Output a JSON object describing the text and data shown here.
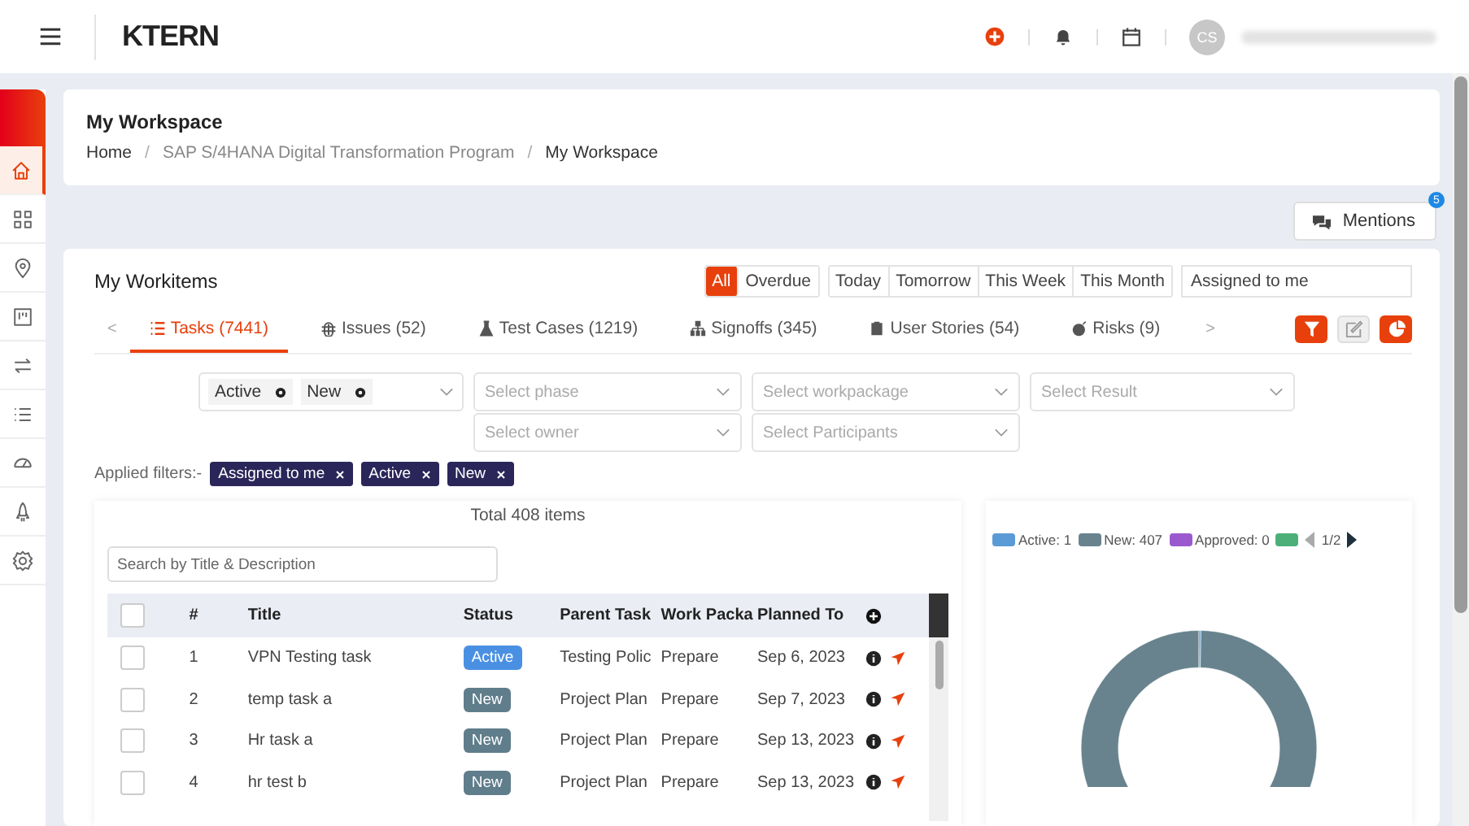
{
  "header": {
    "logo": "KTERN",
    "avatar": "CS"
  },
  "sidebar": {
    "items": [
      {
        "kind": "home",
        "selected": true
      },
      {
        "kind": "grid",
        "selected": false
      },
      {
        "kind": "pin",
        "selected": false
      },
      {
        "kind": "board",
        "selected": false
      },
      {
        "kind": "swap",
        "selected": false
      },
      {
        "kind": "list",
        "selected": false
      },
      {
        "kind": "gauge",
        "selected": false
      },
      {
        "kind": "rocket",
        "selected": false
      },
      {
        "kind": "gear",
        "selected": false
      }
    ]
  },
  "page": {
    "title": "My Workspace",
    "breadcrumb": [
      {
        "label": "Home"
      },
      {
        "label": "SAP S/4HANA Digital Transformation Program"
      },
      {
        "label": "My Workspace"
      }
    ],
    "separator": "/"
  },
  "mentions": {
    "label": "Mentions",
    "badge": "5"
  },
  "workitems": {
    "title": "My Workitems",
    "status_filters": [
      {
        "label": "All",
        "selected": true
      },
      {
        "label": "Overdue",
        "selected": false
      }
    ],
    "date_filters": [
      {
        "label": "Today",
        "selected": false
      },
      {
        "label": "Tomorrow",
        "selected": false
      },
      {
        "label": "This Week",
        "selected": false
      },
      {
        "label": "This Month",
        "selected": false
      }
    ],
    "assignee": "Assigned to me",
    "tabs": [
      {
        "label": "Tasks (7441)",
        "kind": "tasks",
        "selected": true
      },
      {
        "label": "Issues (52)",
        "kind": "issues",
        "selected": false
      },
      {
        "label": "Test Cases (1219)",
        "kind": "tests",
        "selected": false
      },
      {
        "label": "Signoffs (345)",
        "kind": "signoffs",
        "selected": false
      },
      {
        "label": "User Stories (54)",
        "kind": "stories",
        "selected": false
      },
      {
        "label": "Risks (9)",
        "kind": "risks",
        "selected": false
      }
    ],
    "tab_prev": "<",
    "tab_next": ">",
    "status_chips": [
      "Active",
      "New"
    ],
    "selects": [
      {
        "placeholder": "Select phase"
      },
      {
        "placeholder": "Select workpackage"
      },
      {
        "placeholder": "Select Result"
      },
      {
        "placeholder": "Select owner"
      },
      {
        "placeholder": "Select Participants"
      }
    ],
    "applied_label": "Applied filters:-",
    "applied": [
      "Assigned to me",
      "Active",
      "New"
    ],
    "total": "Total 408 items",
    "search": {
      "placeholder": "Search by Title & Description"
    },
    "table": {
      "select_all_checked": false,
      "columns": [
        "#",
        "Title",
        "Status",
        "Parent Task",
        "Work Packa",
        "Planned To"
      ],
      "rows": [
        {
          "checked": false,
          "num": "1",
          "title": "VPN Testing task",
          "status": "Active",
          "color": "#4a90e2",
          "parent": "Testing Polic",
          "work_package": "Prepare",
          "planned": "Sep 6, 2023"
        },
        {
          "checked": false,
          "num": "2",
          "title": "temp task a",
          "status": "New",
          "color": "#607d8b",
          "parent": "Project Plan",
          "work_package": "Prepare",
          "planned": "Sep 7, 2023"
        },
        {
          "checked": false,
          "num": "3",
          "title": "Hr task a",
          "status": "New",
          "color": "#607d8b",
          "parent": "Project Plan",
          "work_package": "Prepare",
          "planned": "Sep 13, 2023"
        },
        {
          "checked": false,
          "num": "4",
          "title": "hr test b",
          "status": "New",
          "color": "#607d8b",
          "parent": "Project Plan",
          "work_package": "Prepare",
          "planned": "Sep 13, 2023"
        }
      ]
    },
    "legend": [
      {
        "color": "#5b9bd5"
      },
      {
        "color": "#68838d"
      },
      {
        "color": "#9b59d0"
      },
      {
        "color": "#4caf7a"
      }
    ],
    "legend_page": "1/2",
    "chart_data": {
      "type": "donut",
      "categories": [
        "Active: 1",
        "New: 407",
        "Approved: 0"
      ],
      "values": [
        1,
        407,
        0
      ]
    }
  }
}
